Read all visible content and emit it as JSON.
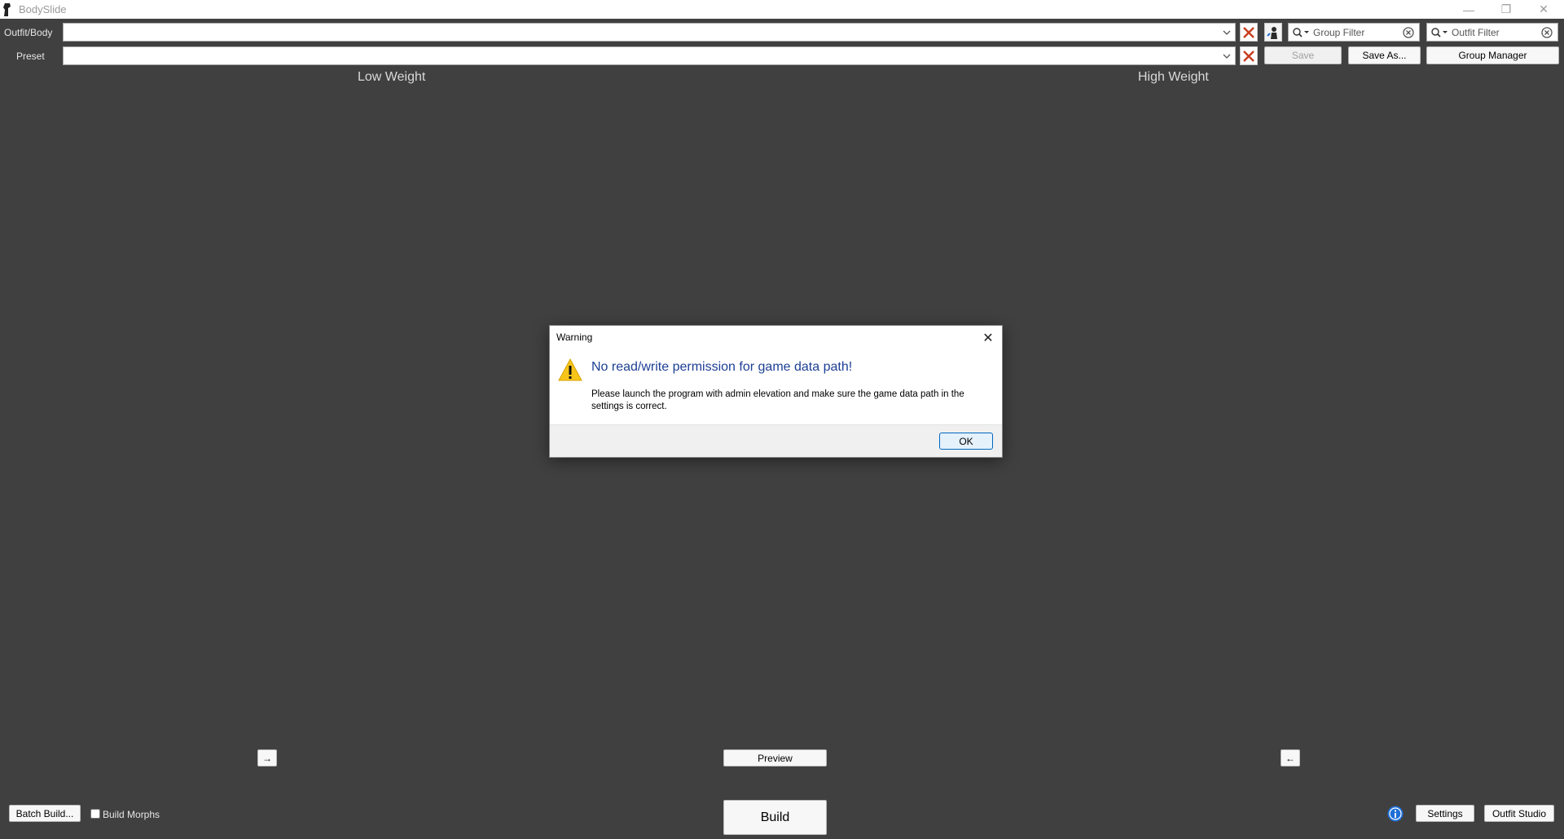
{
  "window": {
    "title": "BodySlide",
    "minimize": "—",
    "maximize": "❐",
    "close": "✕"
  },
  "toolbar": {
    "outfit_label": "Outfit/Body",
    "preset_label": "Preset",
    "outfit_value": "",
    "preset_value": "",
    "group_filter_placeholder": "Group Filter",
    "outfit_filter_placeholder": "Outfit Filter",
    "save_label": "Save",
    "save_as_label": "Save As...",
    "group_manager_label": "Group Manager"
  },
  "panels": {
    "low_weight": "Low Weight",
    "high_weight": "High Weight",
    "copy_right_arrow": "→",
    "copy_left_arrow": "←",
    "preview_label": "Preview"
  },
  "bottom": {
    "batch_build_label": "Batch Build...",
    "build_morphs_label": "Build Morphs",
    "build_morphs_checked": false,
    "build_label": "Build",
    "settings_label": "Settings",
    "outfit_studio_label": "Outfit Studio"
  },
  "dialog": {
    "title": "Warning",
    "heading": "No read/write permission for game data path!",
    "body": "Please launch the program with admin elevation and make sure the game data path in the settings is correct.",
    "ok_label": "OK",
    "close": "✕"
  },
  "colors": {
    "background": "#404040",
    "dialog_heading": "#1c3f94",
    "clear_x": "#c83c1e",
    "info_blue": "#1f6fd6"
  }
}
